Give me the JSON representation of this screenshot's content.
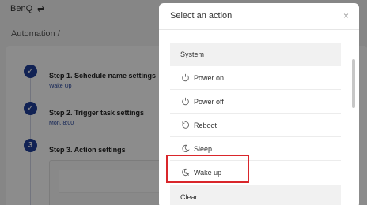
{
  "app": {
    "brand": "BenQ",
    "breadcrumb": "Automation /",
    "steps": [
      {
        "title": "Step 1. Schedule name settings",
        "subtitle": "Wake Up",
        "status": "done"
      },
      {
        "title": "Step 2. Trigger task settings",
        "subtitle": "Mon, 8:00",
        "status": "done"
      },
      {
        "title": "Step 3. Action settings",
        "number": "3",
        "status": "current"
      }
    ]
  },
  "modal": {
    "title": "Select an action",
    "close_icon": "×",
    "sections": [
      {
        "label": "System",
        "items": [
          {
            "label": "Power on",
            "icon": "power-icon"
          },
          {
            "label": "Power off",
            "icon": "power-icon"
          },
          {
            "label": "Reboot",
            "icon": "reboot-icon"
          },
          {
            "label": "Sleep",
            "icon": "moon-icon"
          },
          {
            "label": "Wake up",
            "icon": "wake-icon",
            "highlighted": true
          }
        ]
      },
      {
        "label": "Clear",
        "items": []
      }
    ]
  },
  "colors": {
    "accent": "#1f3f9a",
    "highlight": "#d9262b"
  }
}
